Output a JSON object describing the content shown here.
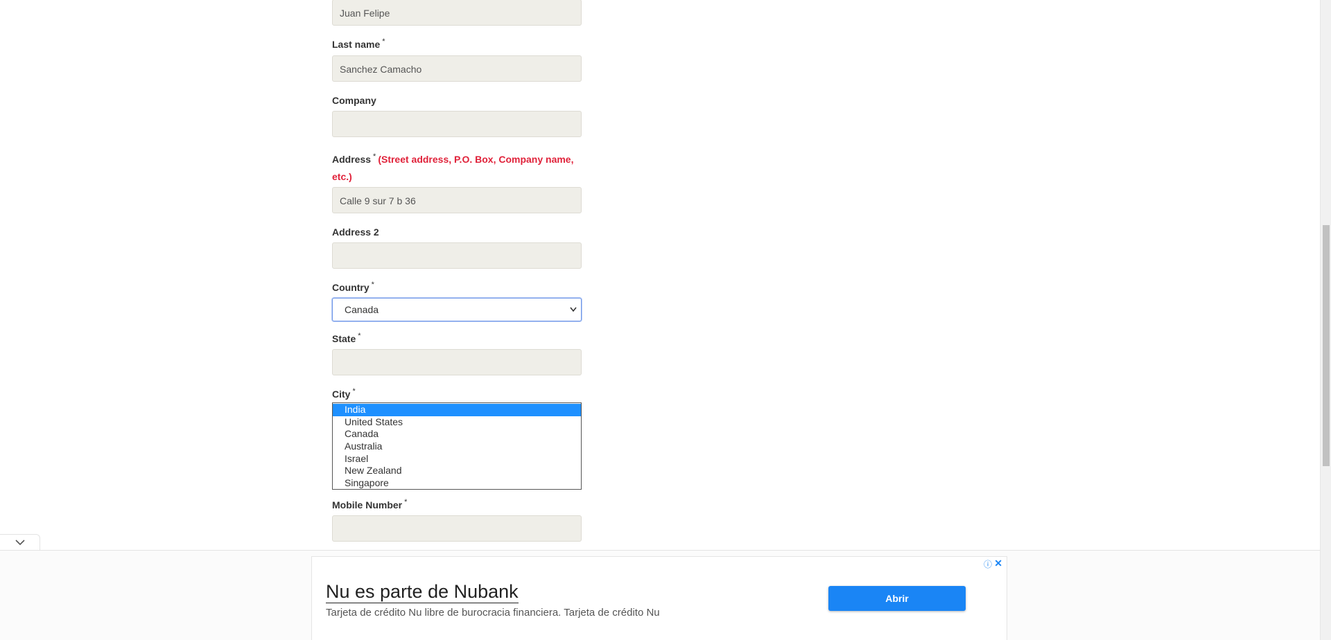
{
  "form": {
    "first_name_value": "Juan Felipe",
    "last_name_label": "Last name",
    "last_name_value": "Sanchez Camacho",
    "company_label": "Company",
    "company_value": "",
    "address_label": "Address",
    "address_hint": "(Street address, P.O. Box, Company name,",
    "address_hint_2": "etc.)",
    "address_value": "Calle 9 sur 7 b 36",
    "address2_label": "Address 2",
    "address2_value": "",
    "country_label": "Country",
    "country_value": "Canada",
    "state_label": "State",
    "state_value": "",
    "city_label": "City",
    "mobile_label": "Mobile Number",
    "mobile_value": "",
    "required_mark": "*"
  },
  "country_dropdown": {
    "options": [
      "India",
      "United States",
      "Canada",
      "Australia",
      "Israel",
      "New Zealand",
      "Singapore"
    ],
    "highlighted": "India"
  },
  "ad": {
    "title": "Nu es parte de Nubank",
    "description": "Tarjeta de crédito Nu libre de burocracia financiera. Tarjeta de crédito Nu",
    "button_label": "Abrir",
    "info_glyph": "ⓘ",
    "close_glyph": "✕"
  },
  "icons": {
    "collapse": "chevron-down-icon",
    "select_arrow": "chevron-down-icon",
    "ad_info": "info-icon",
    "ad_close": "close-icon"
  },
  "colors": {
    "accent": "#1a85f5",
    "highlight": "#1e90ff",
    "required_hint": "#e0223a",
    "input_bg": "#efeee8"
  }
}
